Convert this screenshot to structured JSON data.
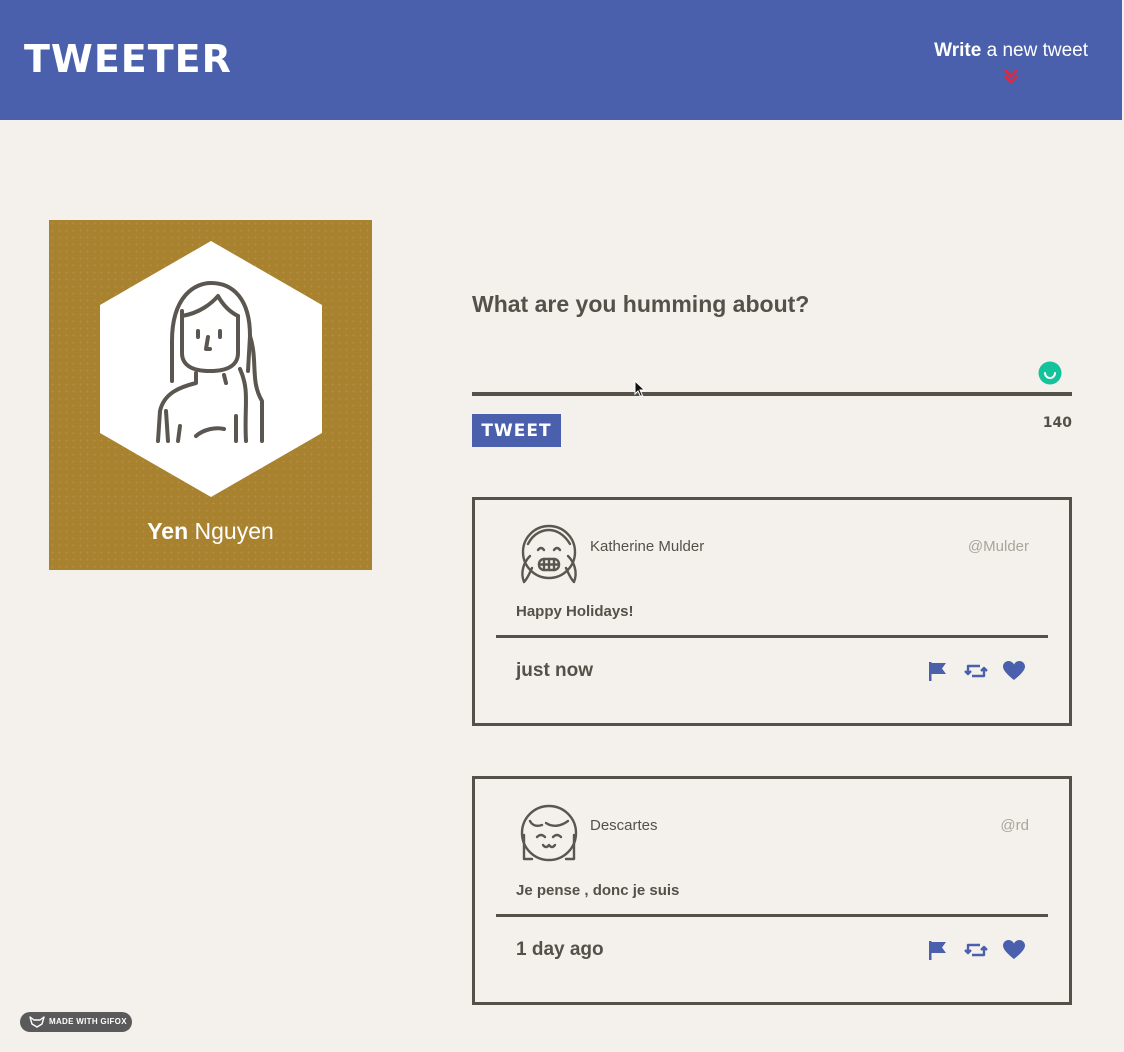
{
  "nav": {
    "brand": "TWEETER",
    "compose_bold": "Write",
    "compose_rest": " a new tweet",
    "compose_icon": "double-chevron-down-icon"
  },
  "profile": {
    "first_name": "Yen",
    "last_name": " Nguyen",
    "background_color": "#a8822f"
  },
  "composer": {
    "heading": "What are you humming about?",
    "textarea_value": "",
    "tweet_button": "TWEET",
    "counter": "140"
  },
  "tweets": [
    {
      "name": "Katherine Mulder",
      "handle": "@Mulder",
      "content": "Happy Holidays!",
      "time": "just now",
      "actions": [
        "flag-icon",
        "retweet-icon",
        "heart-icon"
      ]
    },
    {
      "name": "Descartes",
      "handle": "@rd",
      "content": "Je pense , donc je suis",
      "time": "1 day ago",
      "actions": [
        "flag-icon",
        "retweet-icon",
        "heart-icon"
      ]
    }
  ],
  "badge": {
    "label": "MADE WITH GIFOX"
  },
  "colors": {
    "primary": "#4a60ac",
    "text": "#545149",
    "background": "#f4f1ed",
    "accent_red": "#e0283c",
    "grammar_green": "#15c39a"
  }
}
